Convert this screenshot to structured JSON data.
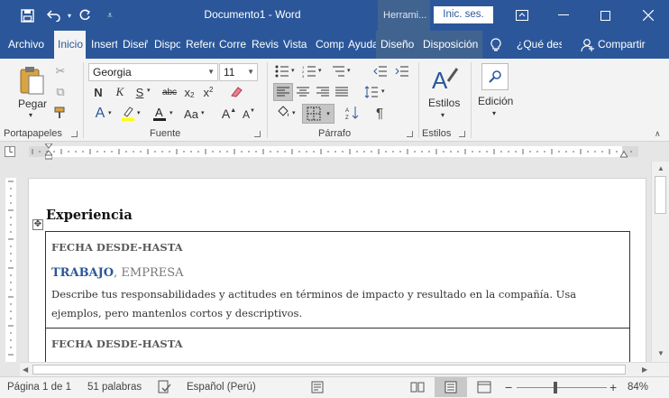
{
  "titlebar": {
    "doc_title": "Documento1  -  Word",
    "contextual_tab": "Herrami...",
    "signin_label": "Inic. ses."
  },
  "tabs": [
    {
      "label": "Archivo",
      "active": false
    },
    {
      "label": "Inicio",
      "active": true
    },
    {
      "label": "Insertar",
      "active": false
    },
    {
      "label": "Diseño",
      "active": false
    },
    {
      "label": "Disposición",
      "active": false
    },
    {
      "label": "Referencias",
      "active": false
    },
    {
      "label": "Correspondencia",
      "active": false
    },
    {
      "label": "Revisar",
      "active": false
    },
    {
      "label": "Vista",
      "active": false
    },
    {
      "label": "Complementos",
      "active": false
    },
    {
      "label": "Ayuda",
      "active": false
    },
    {
      "label": "Diseño",
      "active": false,
      "contextual": true
    },
    {
      "label": "Disposición",
      "active": false,
      "contextual": true
    },
    {
      "label": "¿Qué desea hacer?",
      "active": false
    },
    {
      "label": "Compartir",
      "active": false
    }
  ],
  "ribbon": {
    "clipboard": {
      "paste_label": "Pegar",
      "group_label": "Portapapeles"
    },
    "font": {
      "font_name": "Georgia",
      "font_size": "11",
      "group_label": "Fuente"
    },
    "paragraph": {
      "group_label": "Párrafo"
    },
    "styles": {
      "label": "Estilos",
      "group_label": "Estilos"
    },
    "editing": {
      "label": "Edición"
    }
  },
  "document": {
    "heading": "Experiencia",
    "entries": [
      {
        "date": "FECHA DESDE-HASTA",
        "job": "TRABAJO",
        "company": ", EMPRESA",
        "description": "Describe tus responsabilidades y actitudes en términos de impacto y resultado en la compañía. Usa ejemplos, pero mantenlos cortos y descriptivos."
      },
      {
        "date": "FECHA DESDE-HASTA"
      }
    ]
  },
  "statusbar": {
    "page": "Página 1 de 1",
    "words": "51 palabras",
    "language": "Español (Perú)",
    "zoom": "84%"
  },
  "colors": {
    "accent": "#2b579a",
    "contextual": "#41638f"
  }
}
